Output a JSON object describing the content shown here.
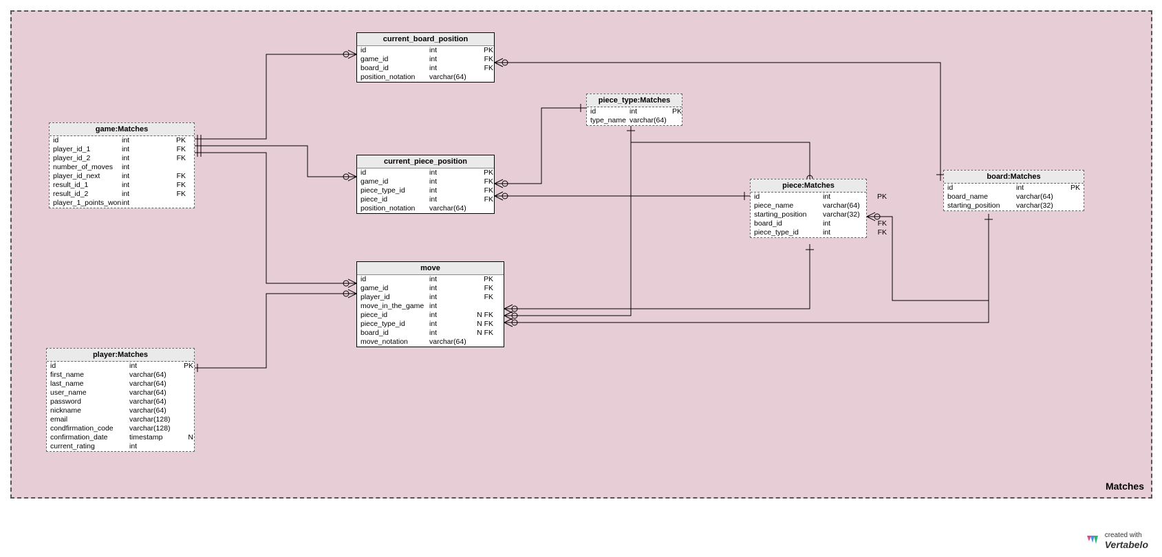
{
  "area_label": "Matches",
  "branding": {
    "pre": "created with",
    "name": "Vertabelo"
  },
  "tables": {
    "game": {
      "title": "game:Matches",
      "cols": [
        {
          "n": "id",
          "t": "int",
          "k": "PK"
        },
        {
          "n": "player_id_1",
          "t": "int",
          "k": "FK"
        },
        {
          "n": "player_id_2",
          "t": "int",
          "k": "FK"
        },
        {
          "n": "number_of_moves",
          "t": "int",
          "k": ""
        },
        {
          "n": "player_id_next",
          "t": "int",
          "k": "FK"
        },
        {
          "n": "result_id_1",
          "t": "int",
          "k": "FK"
        },
        {
          "n": "result_id_2",
          "t": "int",
          "k": "FK"
        },
        {
          "n": "player_1_points_won",
          "t": "int",
          "k": ""
        }
      ]
    },
    "player": {
      "title": "player:Matches",
      "cols": [
        {
          "n": "id",
          "t": "int",
          "k": "PK"
        },
        {
          "n": "first_name",
          "t": "varchar(64)",
          "k": ""
        },
        {
          "n": "last_name",
          "t": "varchar(64)",
          "k": ""
        },
        {
          "n": "user_name",
          "t": "varchar(64)",
          "k": ""
        },
        {
          "n": "password",
          "t": "varchar(64)",
          "k": ""
        },
        {
          "n": "nickname",
          "t": "varchar(64)",
          "k": ""
        },
        {
          "n": "email",
          "t": "varchar(128)",
          "k": ""
        },
        {
          "n": "condfirmation_code",
          "t": "varchar(128)",
          "k": ""
        },
        {
          "n": "confirmation_date",
          "t": "timestamp",
          "k": "N"
        },
        {
          "n": "current_rating",
          "t": "int",
          "k": ""
        }
      ]
    },
    "cbp": {
      "title": "current_board_position",
      "cols": [
        {
          "n": "id",
          "t": "int",
          "k": "PK"
        },
        {
          "n": "game_id",
          "t": "int",
          "k": "FK"
        },
        {
          "n": "board_id",
          "t": "int",
          "k": "FK"
        },
        {
          "n": "position_notation",
          "t": "varchar(64)",
          "k": ""
        }
      ]
    },
    "cpp": {
      "title": "current_piece_position",
      "cols": [
        {
          "n": "id",
          "t": "int",
          "k": "PK"
        },
        {
          "n": "game_id",
          "t": "int",
          "k": "FK"
        },
        {
          "n": "piece_type_id",
          "t": "int",
          "k": "FK"
        },
        {
          "n": "piece_id",
          "t": "int",
          "k": "FK"
        },
        {
          "n": "position_notation",
          "t": "varchar(64)",
          "k": ""
        }
      ]
    },
    "move": {
      "title": "move",
      "cols": [
        {
          "n": "id",
          "t": "int",
          "k": "PK"
        },
        {
          "n": "game_id",
          "t": "int",
          "k": "FK"
        },
        {
          "n": "player_id",
          "t": "int",
          "k": "FK"
        },
        {
          "n": "move_in_the_game",
          "t": "int",
          "k": ""
        },
        {
          "n": "piece_id",
          "t": "int",
          "k": "N FK"
        },
        {
          "n": "piece_type_id",
          "t": "int",
          "k": "N FK"
        },
        {
          "n": "board_id",
          "t": "int",
          "k": "N FK"
        },
        {
          "n": "move_notation",
          "t": "varchar(64)",
          "k": ""
        }
      ]
    },
    "piece_type": {
      "title": "piece_type:Matches",
      "cols": [
        {
          "n": "id",
          "t": "int",
          "k": "PK"
        },
        {
          "n": "type_name",
          "t": "varchar(64)",
          "k": ""
        }
      ]
    },
    "piece": {
      "title": "piece:Matches",
      "cols": [
        {
          "n": "id",
          "t": "int",
          "k": "PK"
        },
        {
          "n": "piece_name",
          "t": "varchar(64)",
          "k": ""
        },
        {
          "n": "starting_position",
          "t": "varchar(32)",
          "k": ""
        },
        {
          "n": "board_id",
          "t": "int",
          "k": "FK"
        },
        {
          "n": "piece_type_id",
          "t": "int",
          "k": "FK"
        }
      ]
    },
    "board": {
      "title": "board:Matches",
      "cols": [
        {
          "n": "id",
          "t": "int",
          "k": "PK"
        },
        {
          "n": "board_name",
          "t": "varchar(64)",
          "k": ""
        },
        {
          "n": "starting_position",
          "t": "varchar(32)",
          "k": ""
        }
      ]
    }
  }
}
